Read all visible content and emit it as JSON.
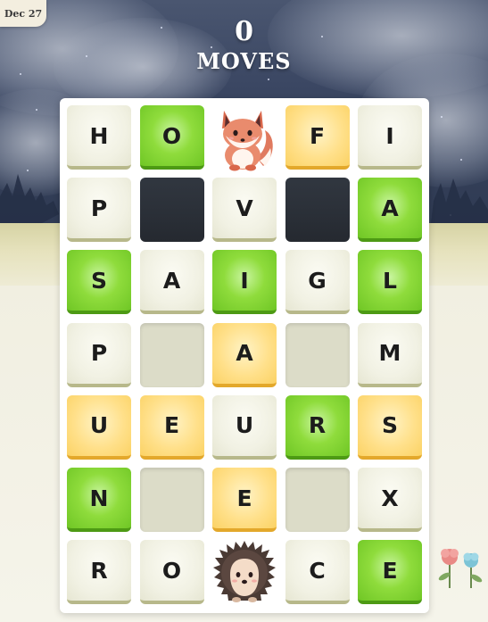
{
  "date": "Dec 27",
  "moves": {
    "count": "0",
    "label": "MOVES"
  },
  "grid": [
    [
      {
        "letter": "H",
        "state": "neutral"
      },
      {
        "letter": "O",
        "state": "green"
      },
      {
        "letter": "",
        "state": "fox"
      },
      {
        "letter": "F",
        "state": "yellow"
      },
      {
        "letter": "I",
        "state": "neutral"
      }
    ],
    [
      {
        "letter": "P",
        "state": "neutral"
      },
      {
        "letter": "",
        "state": "dark"
      },
      {
        "letter": "V",
        "state": "neutral"
      },
      {
        "letter": "",
        "state": "dark"
      },
      {
        "letter": "A",
        "state": "green"
      }
    ],
    [
      {
        "letter": "S",
        "state": "green"
      },
      {
        "letter": "A",
        "state": "neutral"
      },
      {
        "letter": "I",
        "state": "green"
      },
      {
        "letter": "G",
        "state": "neutral"
      },
      {
        "letter": "L",
        "state": "green"
      }
    ],
    [
      {
        "letter": "P",
        "state": "neutral"
      },
      {
        "letter": "",
        "state": "empty"
      },
      {
        "letter": "A",
        "state": "yellow"
      },
      {
        "letter": "",
        "state": "empty"
      },
      {
        "letter": "M",
        "state": "neutral"
      }
    ],
    [
      {
        "letter": "U",
        "state": "yellow"
      },
      {
        "letter": "E",
        "state": "yellow"
      },
      {
        "letter": "U",
        "state": "neutral"
      },
      {
        "letter": "R",
        "state": "green"
      },
      {
        "letter": "S",
        "state": "yellow"
      }
    ],
    [
      {
        "letter": "N",
        "state": "green"
      },
      {
        "letter": "",
        "state": "empty"
      },
      {
        "letter": "E",
        "state": "yellow"
      },
      {
        "letter": "",
        "state": "empty"
      },
      {
        "letter": "X",
        "state": "neutral"
      }
    ],
    [
      {
        "letter": "R",
        "state": "neutral"
      },
      {
        "letter": "O",
        "state": "neutral"
      },
      {
        "letter": "",
        "state": "hedgehog"
      },
      {
        "letter": "C",
        "state": "neutral"
      },
      {
        "letter": "E",
        "state": "green"
      }
    ]
  ],
  "colors": {
    "correct": "#8fdc3c",
    "misplaced": "#ffe08a",
    "neutral": "#f1f1e3",
    "empty": "#dcdcc8"
  }
}
